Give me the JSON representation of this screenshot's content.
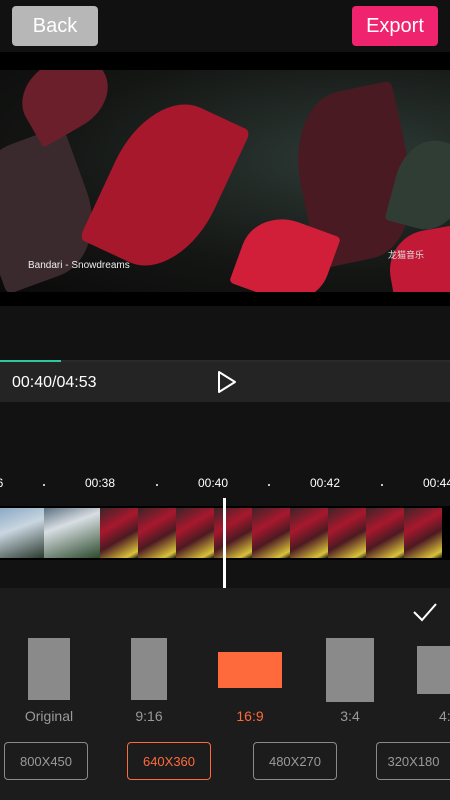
{
  "header": {
    "back_label": "Back",
    "export_label": "Export"
  },
  "video": {
    "caption": "Bandari - Snowdreams",
    "watermark": "龙猫音乐"
  },
  "playback": {
    "time": "00:40/04:53",
    "progress_fraction": 0.135
  },
  "timeline": {
    "ticks": [
      "6",
      "00:38",
      "00:40",
      "00:42",
      "00:44"
    ]
  },
  "aspect_ratios": [
    {
      "label": "Original",
      "selected": false
    },
    {
      "label": "9:16",
      "selected": false
    },
    {
      "label": "16:9",
      "selected": true
    },
    {
      "label": "3:4",
      "selected": false
    },
    {
      "label": "4:",
      "selected": false
    }
  ],
  "resolutions": [
    {
      "label": "800X450",
      "selected": false
    },
    {
      "label": "640X360",
      "selected": true
    },
    {
      "label": "480X270",
      "selected": false
    },
    {
      "label": "320X180",
      "selected": false
    }
  ],
  "colors": {
    "export": "#f0246e",
    "accent": "#ff6a3d",
    "progress": "#2ec7a0"
  },
  "icons": {
    "play": "play-icon",
    "confirm": "checkmark-icon"
  }
}
